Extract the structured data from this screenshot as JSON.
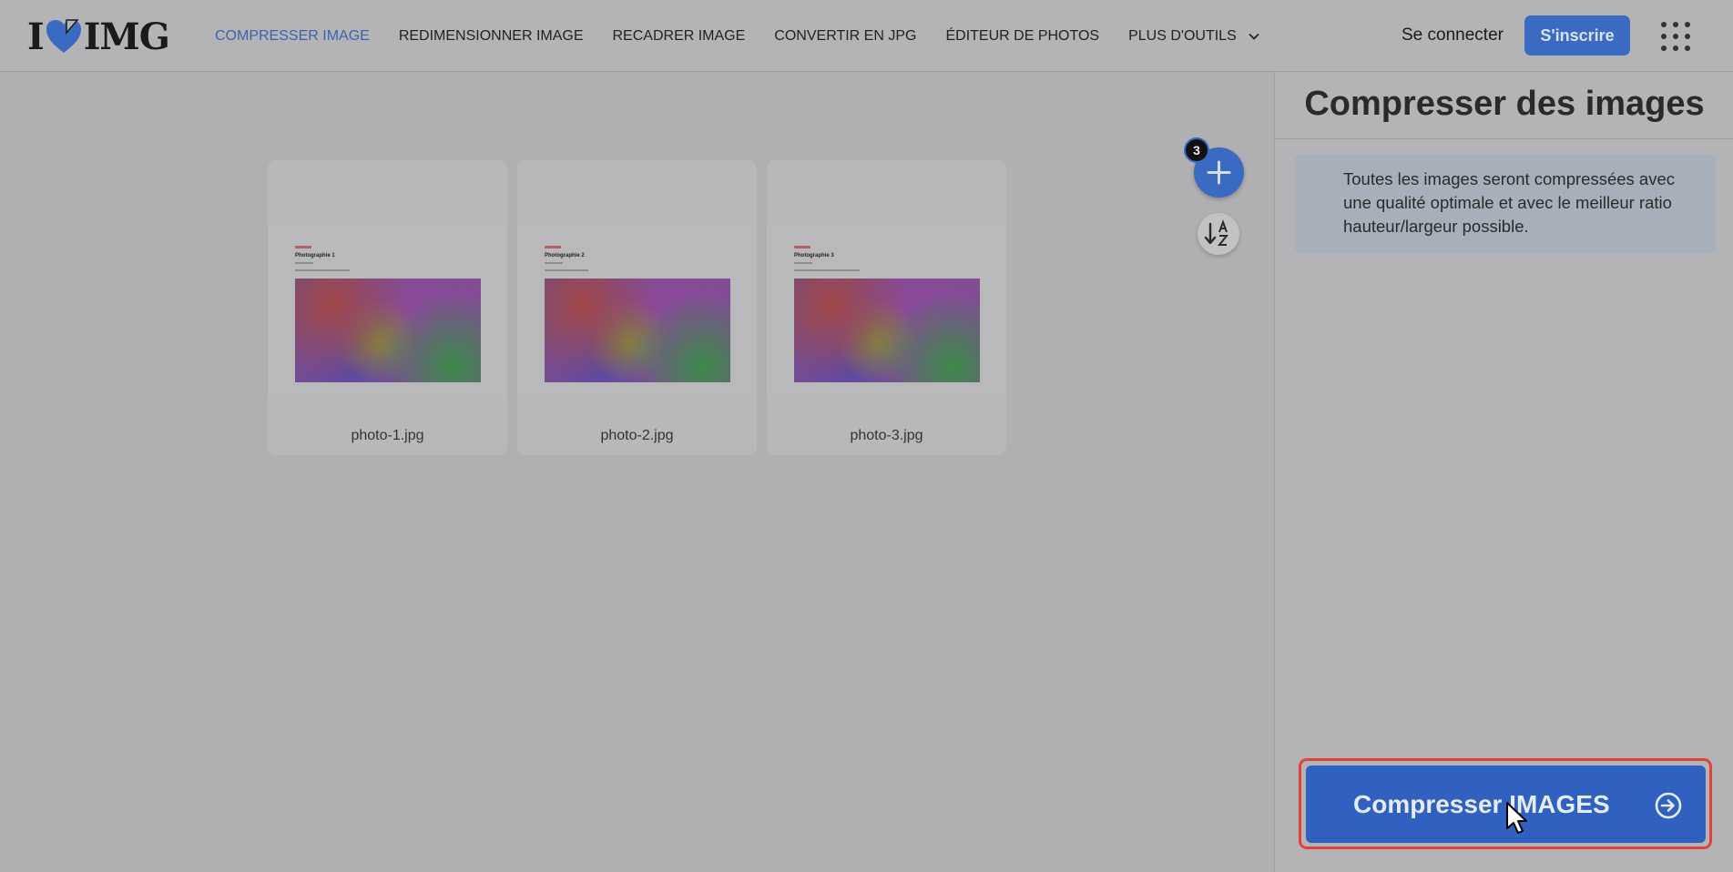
{
  "logo": {
    "left": "I",
    "right": "IMG",
    "heart_color": "#3a6ac2"
  },
  "nav": {
    "items": [
      {
        "label": "COMPRESSER IMAGE",
        "active": true
      },
      {
        "label": "REDIMENSIONNER IMAGE"
      },
      {
        "label": "RECADRER IMAGE"
      },
      {
        "label": "CONVERTIR EN JPG"
      },
      {
        "label": "ÉDITEUR DE PHOTOS"
      },
      {
        "label": "PLUS D'OUTILS"
      }
    ],
    "more_icon": "chevron-down-icon"
  },
  "auth": {
    "login": "Se connecter",
    "signup": "S'inscrire"
  },
  "apps_icon": "grid-icon",
  "files": [
    {
      "name": "photo-1.jpg",
      "doc_title": "Photographie 1"
    },
    {
      "name": "photo-2.jpg",
      "doc_title": "Photographie 2"
    },
    {
      "name": "photo-3.jpg",
      "doc_title": "Photographie 3"
    }
  ],
  "file_count": "3",
  "sidebar": {
    "title": "Compresser des images",
    "info": "Toutes les images seront compressées avec une qualité optimale et avec le meilleur ratio hauteur/largeur possible.",
    "action": "Compresser IMAGES"
  },
  "colors": {
    "accent": "#3a6ac2",
    "highlight": "#e0413a"
  }
}
